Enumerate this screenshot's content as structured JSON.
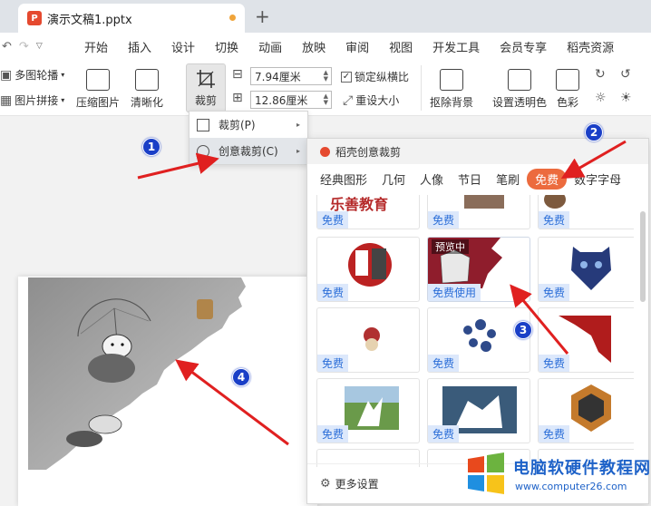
{
  "window": {
    "tab_title": "演示文稿1.pptx",
    "new_tab": "+",
    "file_badge": "P"
  },
  "menubar": {
    "items": [
      "开始",
      "插入",
      "设计",
      "切换",
      "动画",
      "放映",
      "审阅",
      "视图",
      "开发工具",
      "会员专享",
      "稻壳资源"
    ]
  },
  "ribbon": {
    "multi_outline": "多图轮播",
    "picture_collage": "图片拼接",
    "compress": "压缩图片",
    "sharpen": "清晰化",
    "crop": "裁剪",
    "width": "7.94厘米",
    "height": "12.86厘米",
    "lock_ratio": "锁定纵横比",
    "reset_size": "重设大小",
    "remove_bg": "抠除背景",
    "set_transparent": "设置透明色",
    "color": "色彩"
  },
  "crop_menu": {
    "items": [
      {
        "label": "裁剪(P)"
      },
      {
        "label": "创意裁剪(C)"
      }
    ]
  },
  "panel": {
    "title": "稻壳创意裁剪",
    "tabs": [
      "经典图形",
      "几何",
      "人像",
      "节日",
      "笔刷",
      "免费",
      "数字字母"
    ],
    "active_tab": "免费",
    "free_label": "免费",
    "free_use_label": "免费使用",
    "preview_label": "预览中",
    "partial_title": "乐善教育",
    "more_settings": "更多设置"
  },
  "annotations": [
    "1",
    "2",
    "3",
    "4"
  ],
  "watermark": {
    "line1": "电脑软硬件教程网",
    "line2": "www.computer26.com"
  },
  "colors": {
    "accent": "#ec6b3e",
    "badge_text": "#2b6ed8",
    "annotation": "#1a3fc7",
    "arrow": "#e02020"
  }
}
